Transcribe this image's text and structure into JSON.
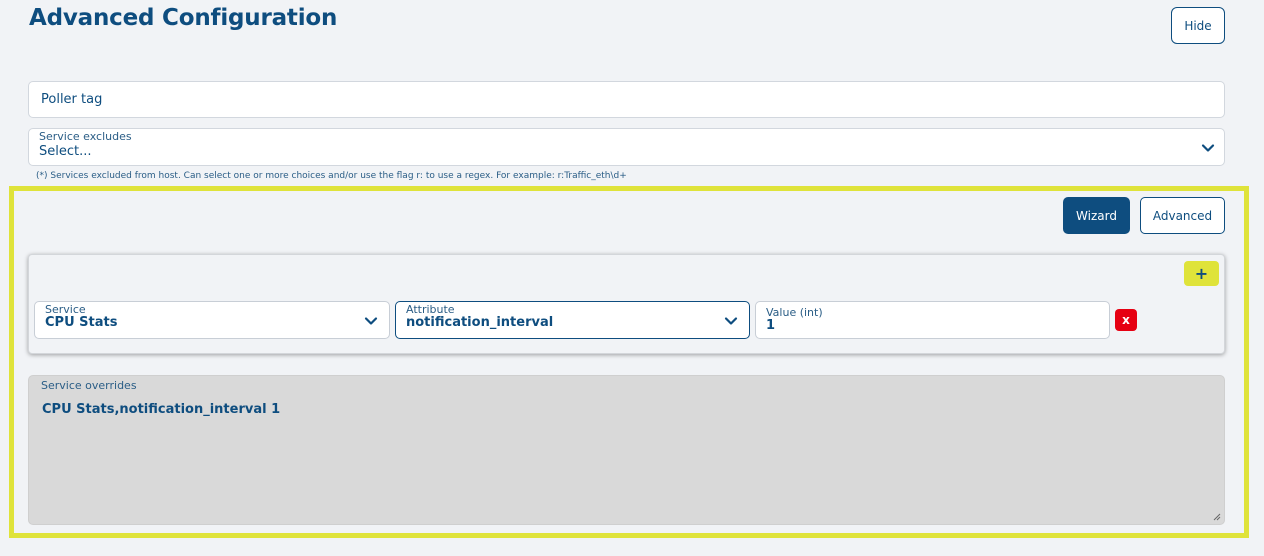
{
  "header": {
    "title": "Advanced Configuration",
    "hide_label": "Hide"
  },
  "poller_tag": {
    "value": "Poller tag"
  },
  "service_excludes": {
    "label": "Service excludes",
    "value": "Select...",
    "help": "(*) Services excluded from host. Can select one or more choices and/or use the flag r: to use a regex. For example: r:Traffic_eth\\d+"
  },
  "mode_buttons": {
    "wizard_label": "Wizard",
    "advanced_label": "Advanced"
  },
  "override_row": {
    "add_label": "+",
    "service": {
      "label": "Service",
      "value": "CPU Stats"
    },
    "attribute": {
      "label": "Attribute",
      "value": "notification_interval"
    },
    "value": {
      "label": "Value (int)",
      "value": "1"
    },
    "remove_label": "x"
  },
  "service_overrides": {
    "label": "Service overrides",
    "value": "CPU Stats,notification_interval 1"
  },
  "colors": {
    "primary": "#0e4d7f",
    "highlight": "#dfe33a",
    "danger": "#e60012",
    "background": "#f1f3f6"
  },
  "icons": {
    "select_arrow": "chevron-down-icon",
    "resize": "resize-grip-icon"
  }
}
